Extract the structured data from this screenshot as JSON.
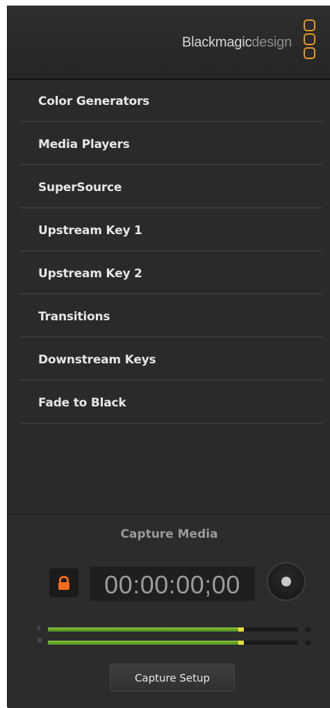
{
  "brand": {
    "name_bold": "Blackmagic",
    "name_light": "design"
  },
  "menu": {
    "items": [
      {
        "label": "Color Generators"
      },
      {
        "label": "Media Players"
      },
      {
        "label": "SuperSource"
      },
      {
        "label": "Upstream Key 1"
      },
      {
        "label": "Upstream Key 2"
      },
      {
        "label": "Transitions"
      },
      {
        "label": "Downstream Keys"
      },
      {
        "label": "Fade to Black"
      }
    ]
  },
  "capture": {
    "title": "Capture Media",
    "timecode": "00:00:00;00",
    "meters": [
      {
        "channel": "L",
        "level": 0.76
      },
      {
        "channel": "R",
        "level": 0.76
      }
    ],
    "setup_label": "Capture Setup"
  },
  "colors": {
    "accent": "#e89a27",
    "lock": "#f26b1d",
    "meter_green": "#6aa82c",
    "meter_peak": "#e8e040"
  }
}
